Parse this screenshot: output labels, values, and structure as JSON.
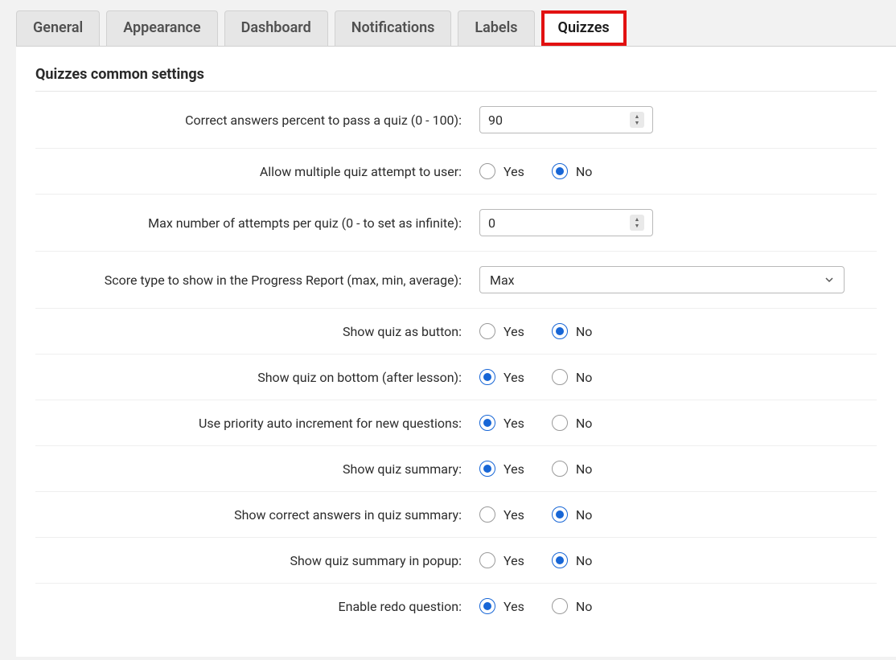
{
  "tabs": {
    "general": "General",
    "appearance": "Appearance",
    "dashboard": "Dashboard",
    "notifications": "Notifications",
    "labels": "Labels",
    "quizzes": "Quizzes"
  },
  "section_title": "Quizzes common settings",
  "labels": {
    "pass_percent": "Correct answers percent to pass a quiz (0 - 100):",
    "allow_multiple": "Allow multiple quiz attempt to user:",
    "max_attempts": "Max number of attempts per quiz (0 - to set as infinite):",
    "score_type": "Score type to show in the Progress Report (max, min, average):",
    "show_as_button": "Show quiz as button:",
    "show_bottom": "Show quiz on bottom (after lesson):",
    "priority_auto": "Use priority auto increment for new questions:",
    "show_summary": "Show quiz summary:",
    "show_correct_summary": "Show correct answers in quiz summary:",
    "show_summary_popup": "Show quiz summary in popup:",
    "enable_redo": "Enable redo question:"
  },
  "values": {
    "pass_percent": "90",
    "max_attempts": "0",
    "score_type": "Max"
  },
  "radio": {
    "yes": "Yes",
    "no": "No"
  }
}
